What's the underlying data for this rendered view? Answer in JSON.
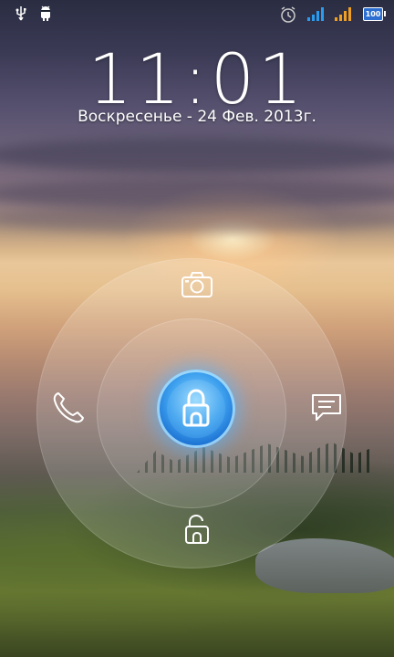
{
  "status_bar": {
    "battery_level": "100",
    "icons": [
      "usb-icon",
      "android-debug-icon",
      "alarm-icon",
      "signal-icon-1",
      "signal-icon-2",
      "battery-icon"
    ],
    "signal1_color": "#2a9cf0",
    "signal2_color": "#f0a020"
  },
  "lockscreen": {
    "time": "11:01",
    "date": "Воскресенье - 24 Фев. 2013г."
  },
  "unlock_ring": {
    "accent": "#2a82de",
    "targets": [
      "camera-target",
      "phone-target",
      "messages-target",
      "unlock-target"
    ]
  }
}
